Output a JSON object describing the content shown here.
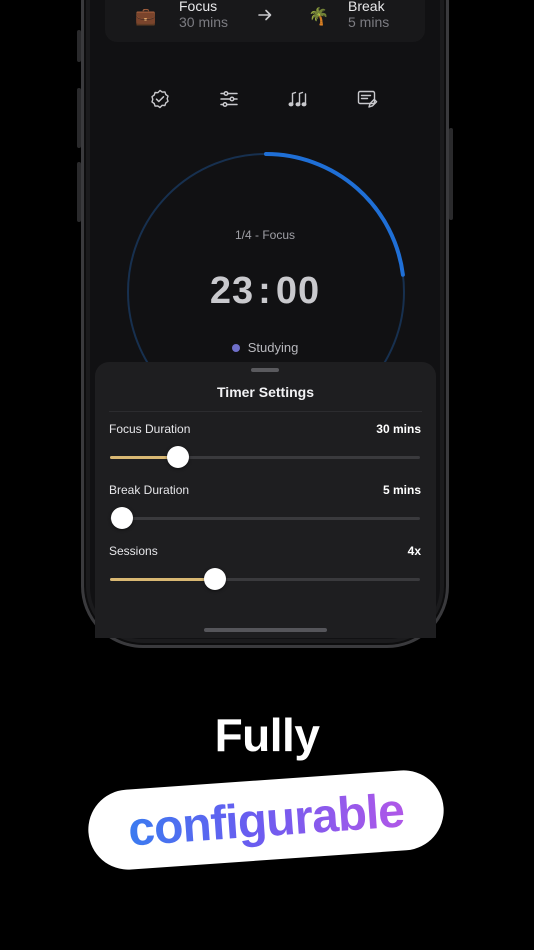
{
  "colors": {
    "background": "#000000",
    "accent_blue": "#1f6fd6",
    "slider_fill": "#d9b873",
    "tag_dot": "#6f6fc9"
  },
  "schedule": {
    "focus": {
      "icon": "briefcase-icon",
      "emoji": "💼",
      "title": "Focus",
      "duration": "30 mins"
    },
    "break": {
      "icon": "palm-tree-icon",
      "emoji": "🌴",
      "title": "Break",
      "duration": "5 mins"
    }
  },
  "toolbar": {
    "icons": [
      "verified-badge-icon",
      "sliders-icon",
      "music-notes-icon",
      "edit-note-icon"
    ]
  },
  "timer": {
    "session_label": "1/4 - Focus",
    "time_minutes": "23",
    "time_seconds": "00",
    "tag": "Studying",
    "progress": 0.23
  },
  "settings_sheet": {
    "title": "Timer Settings",
    "items": [
      {
        "label": "Focus Duration",
        "value": "30 mins",
        "level": 0.22
      },
      {
        "label": "Break Duration",
        "value": "5 mins",
        "level": 0.0
      },
      {
        "label": "Sessions",
        "value": "4x",
        "level": 0.34
      }
    ]
  },
  "headline": {
    "line1": "Fully",
    "line2": "configurable"
  }
}
